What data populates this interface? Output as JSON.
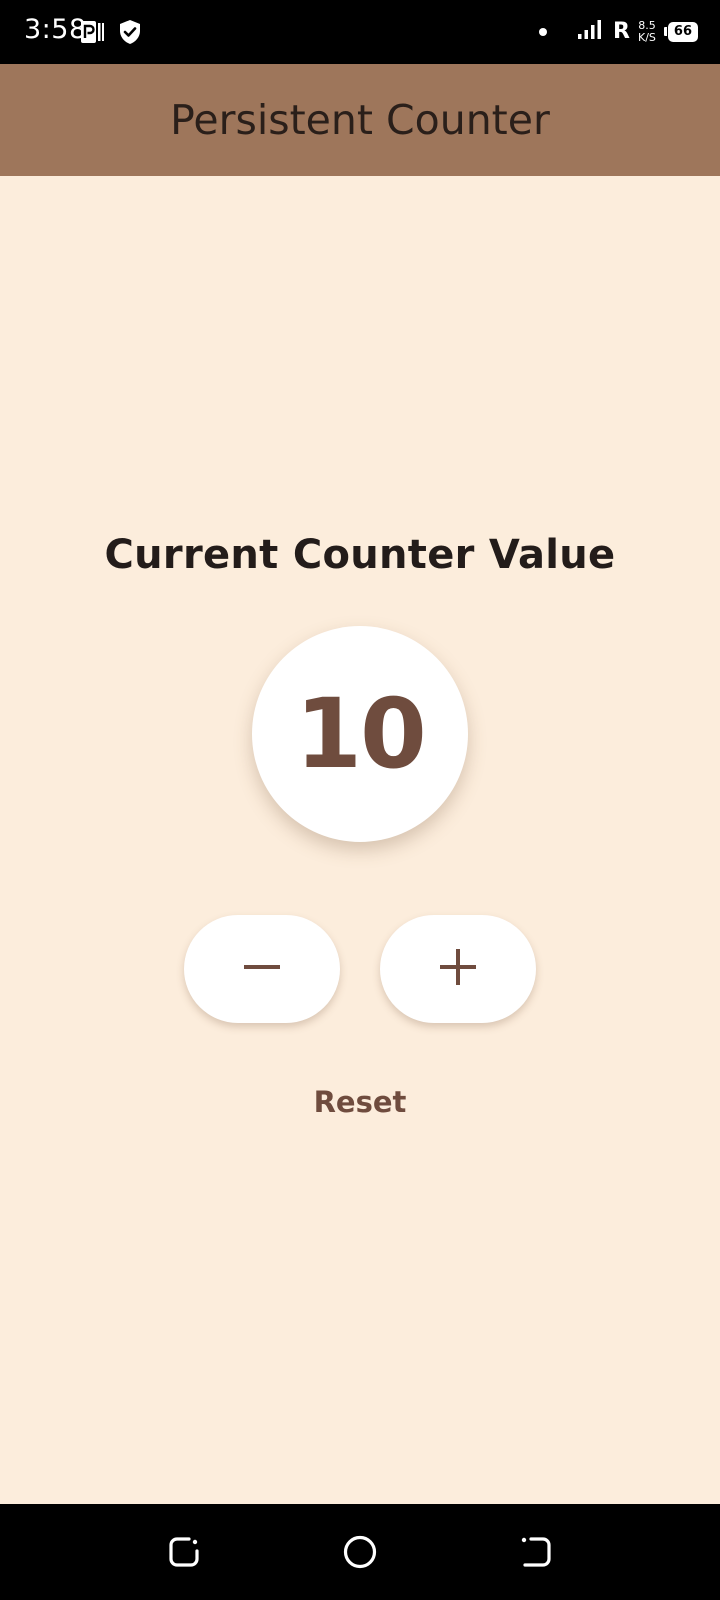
{
  "status_bar": {
    "time": "3:58",
    "roaming": "R",
    "net_speed_value": "8.5",
    "net_speed_unit": "K/S",
    "battery": "66",
    "icons": [
      "parking-icon",
      "shield-check-icon",
      "notification-dot-icon",
      "signal-icon",
      "battery-icon"
    ]
  },
  "app_bar": {
    "title": "Persistent Counter"
  },
  "main": {
    "heading": "Current Counter Value",
    "counter_value": "10",
    "decrement_icon": "minus-icon",
    "increment_icon": "plus-icon",
    "reset_label": "Reset"
  },
  "nav_bar": {
    "icons": [
      "recents-icon",
      "home-icon",
      "back-icon"
    ]
  },
  "colors": {
    "background": "#FCEDDC",
    "app_bar": "#9E765B",
    "accent": "#6F4C3E",
    "status_bar": "#000000"
  }
}
